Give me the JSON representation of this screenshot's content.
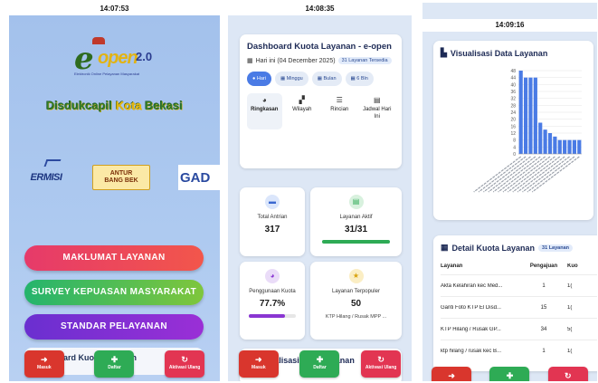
{
  "screen1": {
    "time": "14:07:53",
    "logo": {
      "e": "e",
      "open": "open",
      "version": "2.0",
      "tagline": "Elektronik Online Pelayanan Masyarakat"
    },
    "org_title_a": "Disdukcapil ",
    "org_title_b": "Kota",
    "org_title_c": " Bekasi",
    "partners": {
      "p1": "ERMISI",
      "p2_top": "ANTUR",
      "p2_bottom": "BANG BEK",
      "p3": "GAD"
    },
    "buttons": [
      "MAKLUMAT LAYANAN",
      "SURVEY KEPUASAN MASYARAKAT",
      "STANDAR PELAYANAN"
    ],
    "card_peek": "Dashboard Kuota Layanan"
  },
  "nav": {
    "masuk": "Masuk",
    "daftar": "Daftar",
    "aktivasi": "Aktivasi Ulang"
  },
  "screen2": {
    "time": "14:08:35",
    "title": "Dashboard Kuota Layanan - e-open",
    "date": "Hari ini (04 December 2025)",
    "available_badge": "31 Layanan Tersedia",
    "periods": [
      "Hari",
      "Minggu",
      "Bulan",
      "6 Bln"
    ],
    "tabs": [
      {
        "label": "Ringkasan"
      },
      {
        "label": "Wilayah"
      },
      {
        "label": "Rincian"
      },
      {
        "label": "Jadwal Hari Ini"
      }
    ],
    "stats": {
      "total_antrian_label": "Total Antrian",
      "total_antrian_value": "317",
      "layanan_aktif_label": "Layanan Aktif",
      "layanan_aktif_value": "31/31",
      "layanan_aktif_fill": 1.0,
      "penggunaan_label": "Penggunaan Kuota",
      "penggunaan_value": "77.7%",
      "penggunaan_fill": 0.777,
      "terpopuler_label": "Layanan Terpopuler",
      "terpopuler_value": "50",
      "terpopuler_name": "KTP Hilang / Rusak MPP ..."
    },
    "viz_title": "Visualisasi Data Layanan"
  },
  "screen3": {
    "time": "14:09:16",
    "viz_title": "Visualisasi Data Layanan",
    "table_title": "Detail Kuota Layanan",
    "table_badge": "31 Layanan",
    "columns": [
      "Layanan",
      "Pengajuan",
      "Kuo"
    ],
    "rows": [
      [
        "Akta Kelahiran kec Med...",
        "1",
        "1("
      ],
      [
        "Ganti Foto KTP El Disd...",
        "15",
        "1("
      ],
      [
        "KTP Hilang / Rusak GP...",
        "34",
        "5("
      ],
      [
        "ktp hilang / rusak kec B...",
        "1",
        "1("
      ]
    ]
  },
  "chart_data": {
    "type": "bar",
    "yticks": [
      "48",
      "44",
      "40",
      "36",
      "32",
      "28",
      "24",
      "20",
      "16",
      "12",
      "8",
      "4",
      "0"
    ],
    "ylim": [
      0,
      48
    ],
    "values": [
      48,
      44,
      44,
      44,
      18,
      14,
      12,
      10,
      8,
      8,
      8,
      8,
      8
    ],
    "bar_color": "#4a7be5",
    "grid": true
  },
  "colors": {
    "primary": "#4a7be5",
    "success": "#2eab55",
    "danger": "#d9362d",
    "purple": "#8a36d2"
  }
}
